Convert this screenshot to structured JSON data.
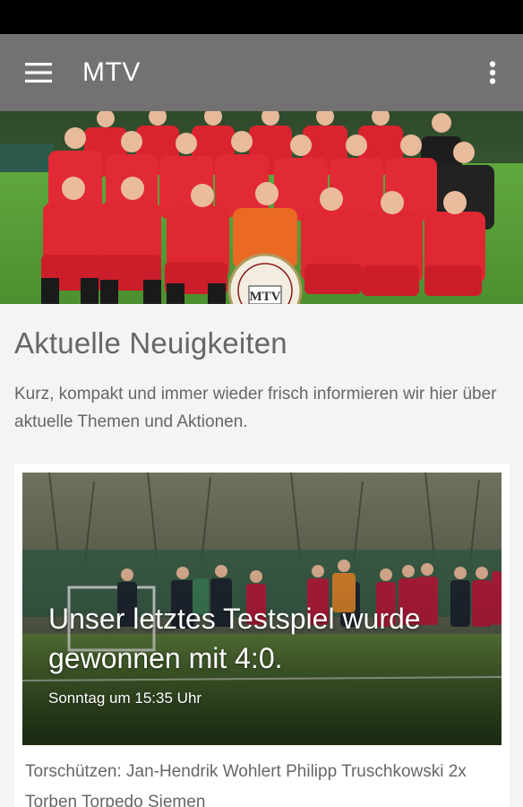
{
  "app_bar": {
    "menu_icon": "hamburger-menu-icon",
    "title": "MTV",
    "overflow_icon": "more-vert-icon",
    "background": "#727272"
  },
  "hero": {
    "image": "team-photo",
    "emblem_text": "MTV"
  },
  "section": {
    "title": "Aktuelle Neuigkeiten",
    "description": "Kurz, kompakt und immer wieder frisch informieren wir hier über aktuelle Themen und Aktionen."
  },
  "news": [
    {
      "image": "football-match-photo",
      "headline": "Unser letztes Testspiel wurde gewonnen mit 4:0.",
      "date": "Sonntag um 15:35 Uhr",
      "body": "Torschützen: Jan-Hendrik Wohlert Philipp Truschkowski 2x Torben Torpedo Siemen"
    }
  ]
}
